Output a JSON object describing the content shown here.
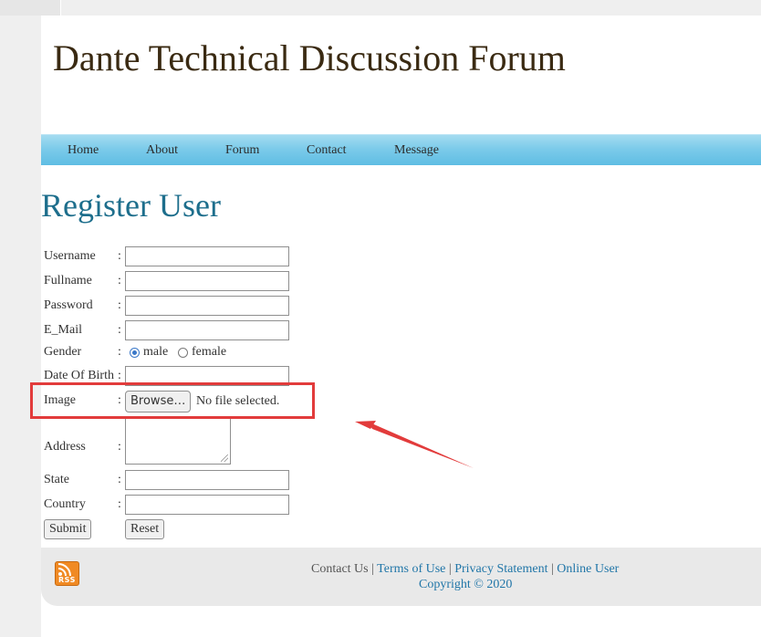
{
  "site": {
    "title": "Dante Technical Discussion Forum"
  },
  "nav": {
    "items": [
      {
        "label": "Home"
      },
      {
        "label": "About"
      },
      {
        "label": "Forum"
      },
      {
        "label": "Contact"
      },
      {
        "label": "Message"
      }
    ]
  },
  "page": {
    "title": "Register User"
  },
  "form": {
    "colon": ":",
    "username": {
      "label": "Username",
      "value": ""
    },
    "fullname": {
      "label": "Fullname",
      "value": ""
    },
    "password": {
      "label": "Password",
      "value": ""
    },
    "email": {
      "label": "E_Mail",
      "value": ""
    },
    "gender": {
      "label": "Gender",
      "options": [
        "male",
        "female"
      ],
      "selected": "male"
    },
    "dob": {
      "label": "Date Of Birth",
      "value": ""
    },
    "image": {
      "label": "Image",
      "browse_label": "Browse…",
      "status": "No file selected."
    },
    "address": {
      "label": "Address",
      "value": ""
    },
    "state": {
      "label": "State",
      "value": ""
    },
    "country": {
      "label": "Country",
      "value": ""
    },
    "submit_label": "Submit",
    "reset_label": "Reset"
  },
  "annotation": {
    "color": "#e23b3b"
  },
  "footer": {
    "rss_label": "RSS",
    "contact": "Contact Us",
    "sep": "|",
    "terms": "Terms of Use",
    "privacy": "Privacy Statement",
    "online": "Online User",
    "copyright": "Copyright © 2020"
  },
  "colors": {
    "title": "#3a2a12",
    "page_title": "#1d6e8c",
    "nav": "#7ccbea",
    "link": "#2176a8"
  }
}
